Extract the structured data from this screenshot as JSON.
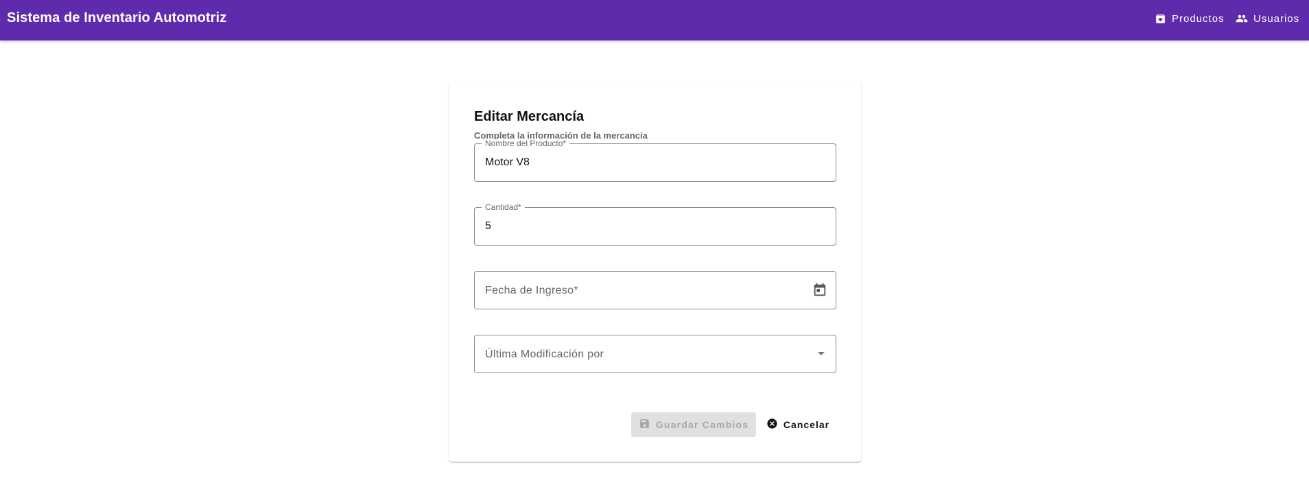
{
  "header": {
    "title": "Sistema de Inventario Automotriz",
    "nav": [
      {
        "label": "Productos",
        "icon": "archive-box-icon"
      },
      {
        "label": "Usuarios",
        "icon": "people-icon"
      }
    ]
  },
  "form": {
    "title": "Editar Mercancía",
    "subtitle": "Completa la información de la mercancía",
    "fields": {
      "product_name": {
        "label": "Nombre del Producto*",
        "value": "Motor V8"
      },
      "quantity": {
        "label": "Cantidad*",
        "value": "5"
      },
      "entry_date": {
        "placeholder": "Fecha de Ingreso*",
        "icon": "calendar-icon"
      },
      "last_modified_by": {
        "placeholder": "Última Modificación por",
        "icon": "chevron-down-icon"
      }
    },
    "buttons": {
      "save_label": "Guardar Cambios",
      "save_icon": "save-icon",
      "save_disabled": true,
      "cancel_label": "Cancelar",
      "cancel_icon": "cancel-circle-icon"
    }
  },
  "colors": {
    "appbar": "#5e2bad",
    "disabled_button_bg": "#e0e0e0",
    "disabled_button_text": "#a6a6a6"
  }
}
